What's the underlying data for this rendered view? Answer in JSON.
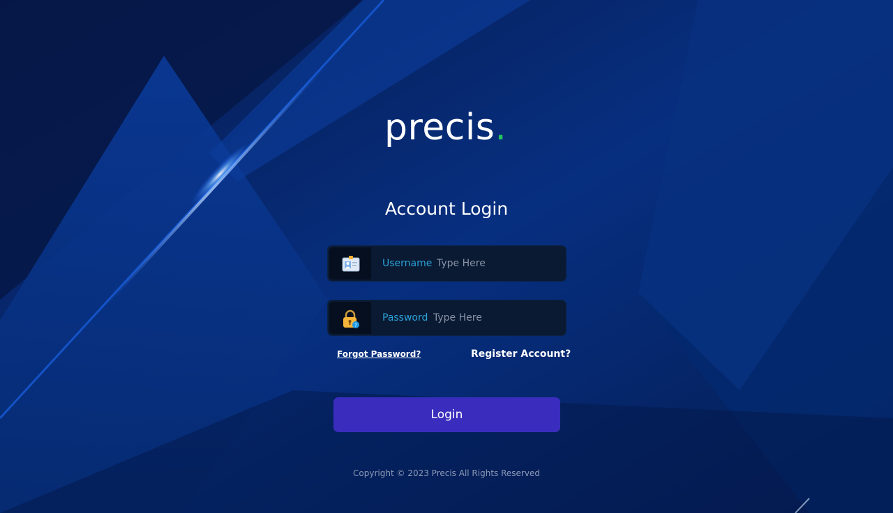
{
  "brand": {
    "logo_text": "precis",
    "logo_dot": ".",
    "accent_color": "#22c55e"
  },
  "login": {
    "title": "Account Login",
    "username": {
      "label": "Username",
      "placeholder": "Type Here",
      "icon": "id-card-icon"
    },
    "password": {
      "label": "Password",
      "placeholder": "Type Here",
      "icon": "lock-icon"
    },
    "forgot_password": "Forgot Password?",
    "register_account": "Register Account?",
    "submit_label": "Login",
    "button_color": "#3a2dbd"
  },
  "footer": {
    "copyright": "Copyright © 2023 Precis All Rights Reserved"
  }
}
